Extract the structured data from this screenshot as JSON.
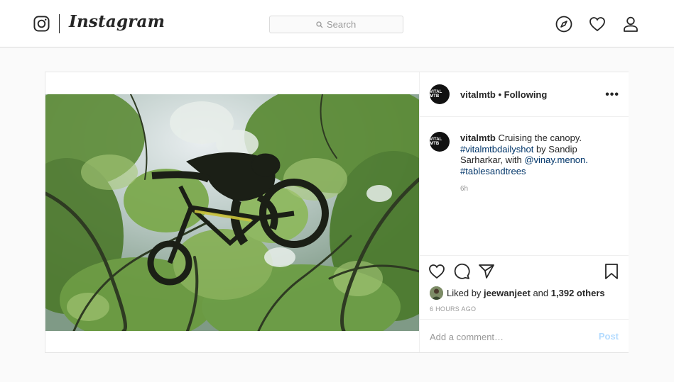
{
  "topbar": {
    "brand": "Instagram",
    "search_placeholder": "Search",
    "icons": [
      "instagram-glyph-icon",
      "search-icon",
      "compass-icon",
      "heart-icon",
      "profile-icon"
    ]
  },
  "post": {
    "username": "vitalmtb",
    "separator": "•",
    "follow_status": "Following",
    "more_label": "•••",
    "avatar_text": "VITAL MTB",
    "caption": {
      "text": "Cruising the canopy.",
      "hashtag1": "#vitalmtbdailyshot",
      "by": "by Sandip Sarharkar, with",
      "mention": "@vinay.menon.",
      "hashtag2": "#tablesandtrees"
    },
    "caption_time": "6h",
    "likes": {
      "prefix": "Liked by",
      "liker": "jeewanjeet",
      "and": "and",
      "others": "1,392 others"
    },
    "timestamp": "6 HOURS AGO",
    "comment_placeholder": "Add a comment…",
    "post_button": "Post"
  },
  "colors": {
    "link": "#003569",
    "post_button_disabled": "#b3dbff",
    "border": "#dbdbdb",
    "background": "#fafafa"
  }
}
